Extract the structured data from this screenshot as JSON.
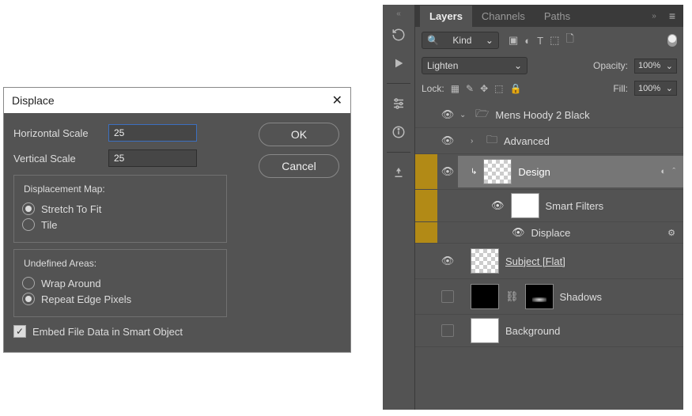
{
  "dialog": {
    "title": "Displace",
    "hscale_label": "Horizontal Scale",
    "hscale_value": "25",
    "vscale_label": "Vertical Scale",
    "vscale_value": "25",
    "map_group": "Displacement Map:",
    "map_stretch": "Stretch To Fit",
    "map_tile": "Tile",
    "undef_group": "Undefined Areas:",
    "undef_wrap": "Wrap Around",
    "undef_repeat": "Repeat Edge Pixels",
    "embed_label": "Embed File Data in Smart Object",
    "ok": "OK",
    "cancel": "Cancel"
  },
  "panel": {
    "tabs": {
      "layers": "Layers",
      "channels": "Channels",
      "paths": "Paths"
    },
    "kind_prefix": "Kind",
    "blend_mode": "Lighten",
    "opacity_label": "Opacity:",
    "opacity_value": "100%",
    "lock_label": "Lock:",
    "fill_label": "Fill:",
    "fill_value": "100%"
  },
  "layers": {
    "group": "Mens Hoody 2 Black",
    "advanced": "Advanced",
    "design": "Design",
    "smart_filters": "Smart Filters",
    "displace": "Displace",
    "subject": "Subject [Flat]",
    "shadows": "Shadows",
    "background": "Background"
  }
}
